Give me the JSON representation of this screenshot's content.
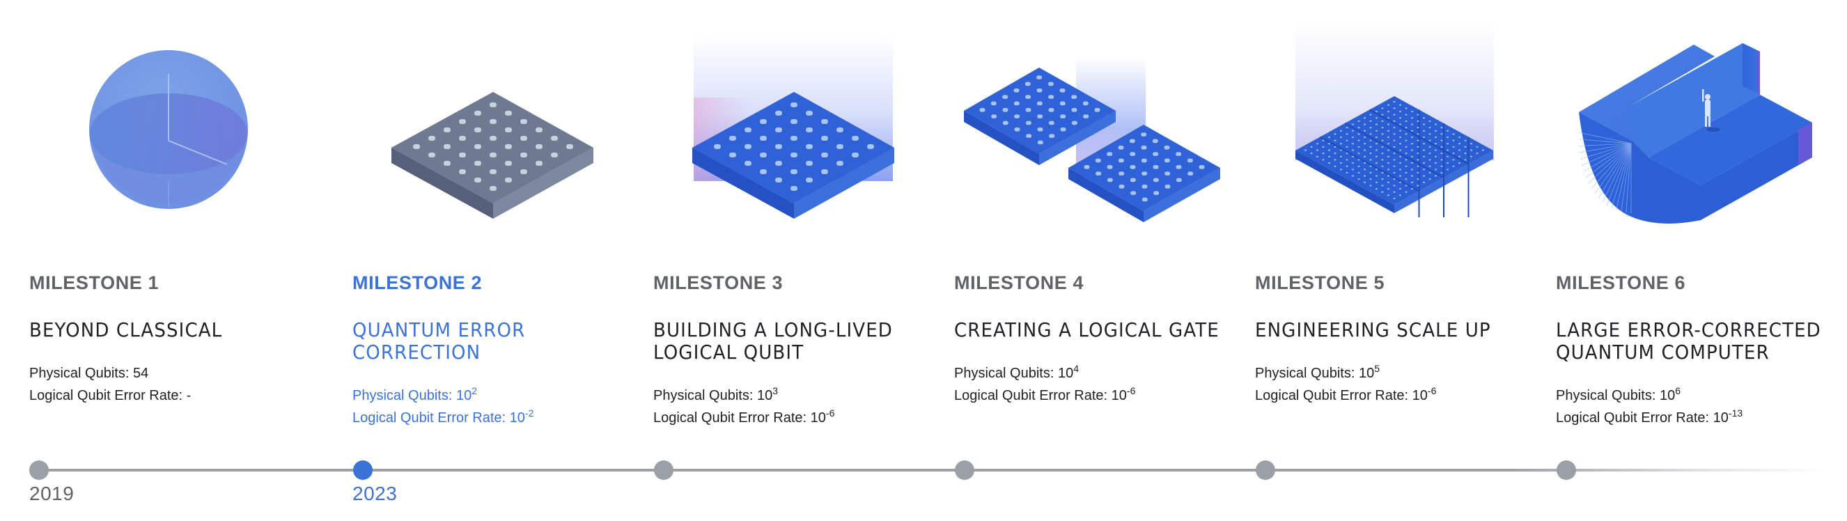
{
  "milestones": [
    {
      "label": "MILESTONE 1",
      "title": [
        "BEYOND CLASSICAL"
      ],
      "physical_qubits_label": "Physical Qubits: ",
      "physical_qubits_base": "54",
      "physical_qubits_exp": "",
      "error_rate_label": "Logical Qubit Error Rate: ",
      "error_rate_base": "-",
      "error_rate_exp": "",
      "year": "2019",
      "active": false,
      "illustration": "sphere-icon"
    },
    {
      "label": "MILESTONE 2",
      "title": [
        "QUANTUM ERROR",
        "CORRECTION"
      ],
      "physical_qubits_label": "Physical Qubits: ",
      "physical_qubits_base": "10",
      "physical_qubits_exp": "2",
      "error_rate_label": "Logical Qubit Error Rate: ",
      "error_rate_base": "10",
      "error_rate_exp": "-2",
      "year": "2023",
      "active": true,
      "illustration": "gray-chip-icon"
    },
    {
      "label": "MILESTONE 3",
      "title": [
        "BUILDING A LONG-LIVED",
        "LOGICAL QUBIT"
      ],
      "physical_qubits_label": "Physical Qubits: ",
      "physical_qubits_base": "10",
      "physical_qubits_exp": "3",
      "error_rate_label": "Logical Qubit Error Rate: ",
      "error_rate_base": "10",
      "error_rate_exp": "-6",
      "year": "",
      "active": false,
      "illustration": "blue-chip-icon"
    },
    {
      "label": "MILESTONE 4",
      "title": [
        "CREATING A LOGICAL GATE"
      ],
      "physical_qubits_label": "Physical Qubits: ",
      "physical_qubits_base": "10",
      "physical_qubits_exp": "4",
      "error_rate_label": "Logical Qubit Error Rate: ",
      "error_rate_base": "10",
      "error_rate_exp": "-6",
      "year": "",
      "active": false,
      "illustration": "two-chips-icon"
    },
    {
      "label": "MILESTONE 5",
      "title": [
        "ENGINEERING SCALE UP"
      ],
      "physical_qubits_label": "Physical Qubits: ",
      "physical_qubits_base": "10",
      "physical_qubits_exp": "5",
      "error_rate_label": "Logical Qubit Error Rate: ",
      "error_rate_base": "10",
      "error_rate_exp": "-6",
      "year": "",
      "active": false,
      "illustration": "tiled-chip-array-icon"
    },
    {
      "label": "MILESTONE 6",
      "title": [
        "LARGE ERROR-CORRECTED",
        "QUANTUM COMPUTER"
      ],
      "physical_qubits_label": "Physical Qubits: ",
      "physical_qubits_base": "10",
      "physical_qubits_exp": "6",
      "error_rate_label": "Logical Qubit Error Rate: ",
      "error_rate_base": "10",
      "error_rate_exp": "-13",
      "year": "",
      "active": false,
      "illustration": "large-quantum-computer-icon"
    }
  ],
  "colors": {
    "active": "#3a72d8",
    "inactive_dot": "#9aa0a6",
    "label_gray": "#5f6368",
    "text": "#202124"
  }
}
